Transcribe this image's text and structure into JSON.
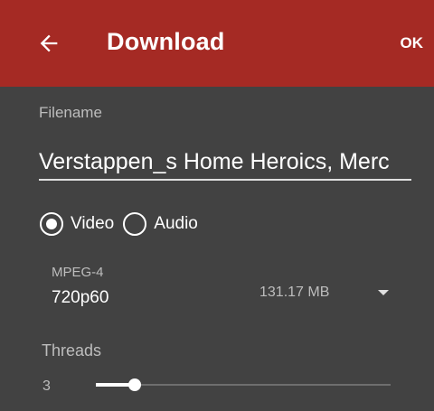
{
  "appbar": {
    "title": "Download",
    "back_icon": "arrow-left-icon",
    "ok_label": "OK",
    "background_color": "#a52a24"
  },
  "filename": {
    "label": "Filename",
    "value": "Verstappen_s Home Heroics, Merc"
  },
  "media_type": {
    "options": [
      {
        "label": "Video",
        "selected": true
      },
      {
        "label": "Audio",
        "selected": false
      }
    ]
  },
  "format": {
    "container": "MPEG-4",
    "quality": "720p60",
    "size": "131.17 MB",
    "dropdown_icon": "dropdown-arrow-icon"
  },
  "threads": {
    "label": "Threads",
    "value": "3",
    "min": 1,
    "max": 16,
    "current": 3
  }
}
